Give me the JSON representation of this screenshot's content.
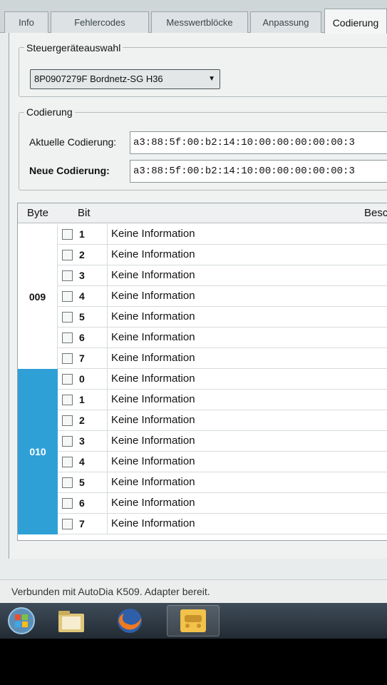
{
  "tabs": [
    {
      "label": "Info"
    },
    {
      "label": "Fehlercodes"
    },
    {
      "label": "Messwertblöcke"
    },
    {
      "label": "Anpassung"
    },
    {
      "label": "Codierung"
    }
  ],
  "ecu_group": {
    "legend": "Steuergeräteauswahl",
    "selected": "8P0907279F Bordnetz-SG    H36"
  },
  "coding_group": {
    "legend": "Codierung",
    "current_label": "Aktuelle Codierung:",
    "current_value": "a3:88:5f:00:b2:14:10:00:00:00:00:00:3",
    "new_label": "Neue Codierung:",
    "new_value": "a3:88:5f:00:b2:14:10:00:00:00:00:00:3"
  },
  "grid": {
    "header_byte": "Byte",
    "header_bit": "Bit",
    "header_desc": "Besc",
    "groups": [
      {
        "byte": "009",
        "bits": [
          {
            "bit": "1",
            "desc": "Keine Information"
          },
          {
            "bit": "2",
            "desc": "Keine Information"
          },
          {
            "bit": "3",
            "desc": "Keine Information"
          },
          {
            "bit": "4",
            "desc": "Keine Information"
          },
          {
            "bit": "5",
            "desc": "Keine Information"
          },
          {
            "bit": "6",
            "desc": "Keine Information"
          },
          {
            "bit": "7",
            "desc": "Keine Information"
          }
        ]
      },
      {
        "byte": "010",
        "bits": [
          {
            "bit": "0",
            "desc": "Keine Information"
          },
          {
            "bit": "1",
            "desc": "Keine Information"
          },
          {
            "bit": "2",
            "desc": "Keine Information"
          },
          {
            "bit": "3",
            "desc": "Keine Information"
          },
          {
            "bit": "4",
            "desc": "Keine Information"
          },
          {
            "bit": "5",
            "desc": "Keine Information"
          },
          {
            "bit": "6",
            "desc": "Keine Information"
          },
          {
            "bit": "7",
            "desc": "Keine Information"
          }
        ]
      }
    ]
  },
  "status_text": "Verbunden mit AutoDia K509. Adapter bereit.",
  "taskbar": {
    "items": [
      "start-orb-icon",
      "file-explorer-icon",
      "firefox-icon",
      "diagnostic-app-icon"
    ]
  },
  "colors": {
    "selected_byte_bg": "#2fa0d6",
    "selected_byte_text": "#ffffff"
  }
}
